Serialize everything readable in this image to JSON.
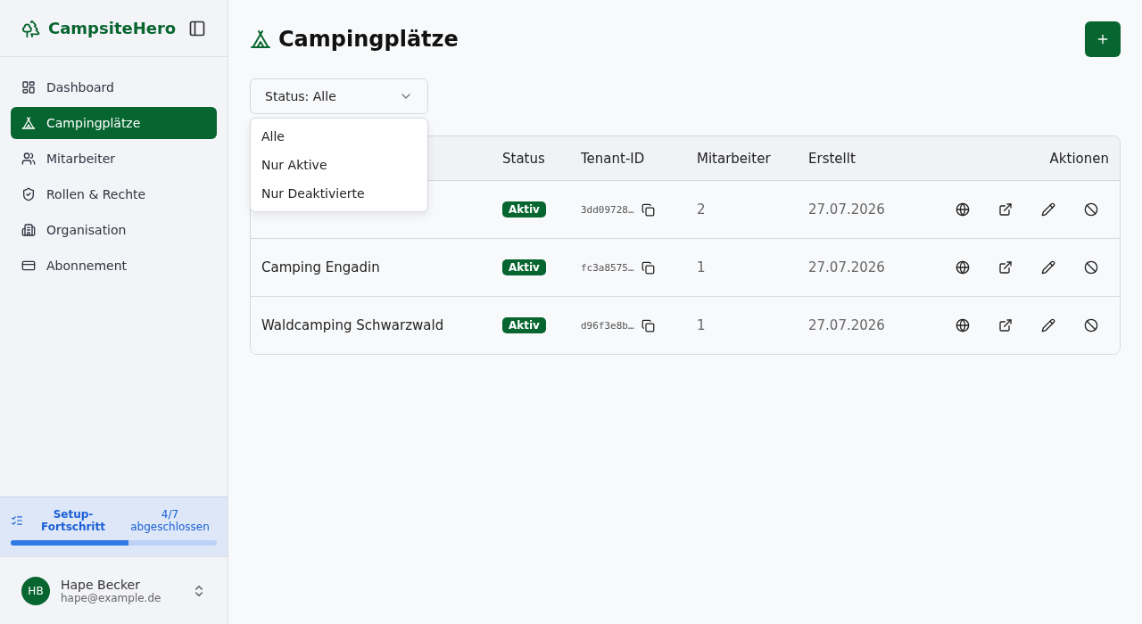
{
  "sidebar": {
    "brand": "CampsiteHero",
    "items": [
      {
        "label": "Dashboard",
        "selected": false
      },
      {
        "label": "Campingplätze",
        "selected": true
      },
      {
        "label": "Mitarbeiter",
        "selected": false
      },
      {
        "label": "Rollen & Rechte",
        "selected": false
      },
      {
        "label": "Organisation",
        "selected": false
      },
      {
        "label": "Abonnement",
        "selected": false
      }
    ],
    "setup": {
      "title": "Setup-Fortschritt",
      "count": "4/7 abgeschlossen",
      "level": 0.57
    },
    "user": {
      "initials": "HB",
      "name": "Hape Becker",
      "email": "hape@example.de"
    }
  },
  "page": {
    "title": "Campingplätze"
  },
  "filter": {
    "value": "Status: Alle",
    "expanded": true,
    "options": [
      "Alle",
      "Nur Aktive",
      "Nur Deaktivierte"
    ]
  },
  "table": {
    "columns": [
      "Status",
      "Tenant-ID",
      "Mitarbeiter",
      "Erstellt",
      "Aktionen"
    ],
    "rows": [
      {
        "status": "Aktiv",
        "tenant_id": "3dd09728…",
        "staff": "2",
        "created": "27.07.2026"
      },
      {
        "name": "Camping Engadin",
        "status": "Aktiv",
        "tenant_id": "fc3a8575…",
        "staff": "1",
        "created": "27.07.2026"
      },
      {
        "name": "Waldcamping Schwarzwald",
        "status": "Aktiv",
        "tenant_id": "d96f3e8b…",
        "staff": "1",
        "created": "27.07.2026"
      }
    ]
  }
}
